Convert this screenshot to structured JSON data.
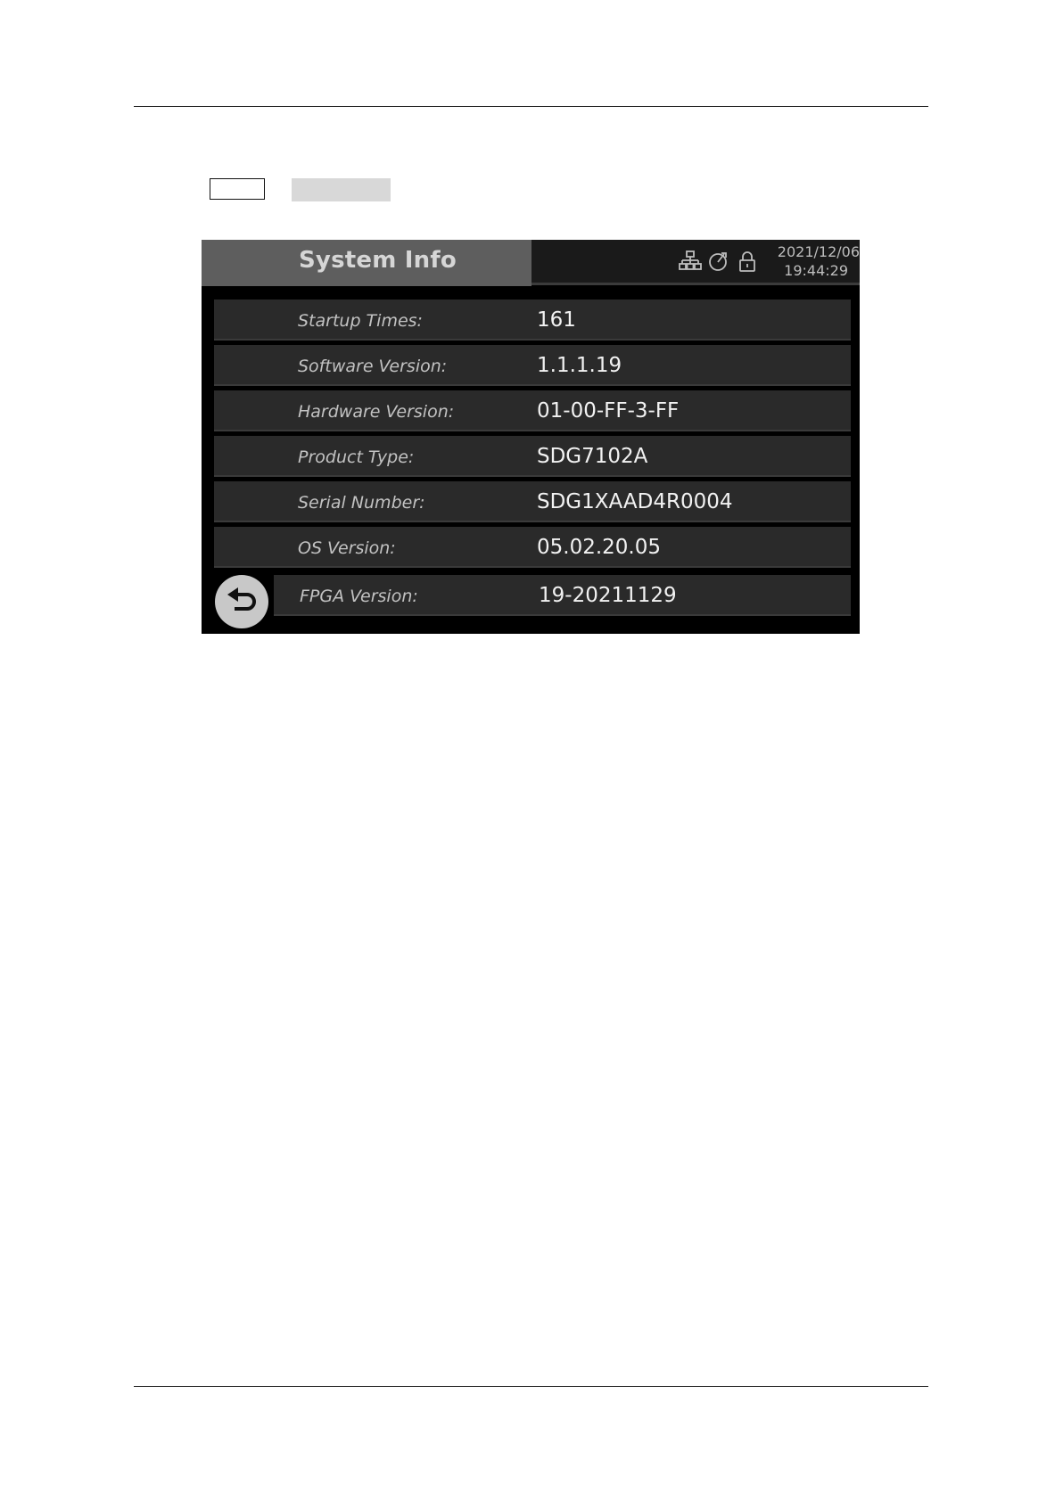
{
  "screen": {
    "title": "System Info",
    "status": {
      "date": "2021/12/06",
      "time": "19:44:29",
      "icons": [
        "network-icon",
        "clock-sync-icon",
        "lock-icon"
      ]
    },
    "rows": [
      {
        "label": "Startup Times:",
        "value": "161"
      },
      {
        "label": "Software Version:",
        "value": "1.1.1.19"
      },
      {
        "label": "Hardware Version:",
        "value": "01-00-FF-3-FF"
      },
      {
        "label": "Product Type:",
        "value": "SDG7102A"
      },
      {
        "label": "Serial Number:",
        "value": "SDG1XAAD4R0004"
      },
      {
        "label": "OS Version:",
        "value": "05.02.20.05"
      },
      {
        "label": "FPGA Version:",
        "value": "19-20211129"
      }
    ],
    "back_icon": "back-arrow-icon"
  },
  "colors": {
    "title_bar": "#5e5e5e",
    "row_bg": "#2a2a2a",
    "screen_bg": "#000000",
    "back_button": "#c8c8c8"
  }
}
